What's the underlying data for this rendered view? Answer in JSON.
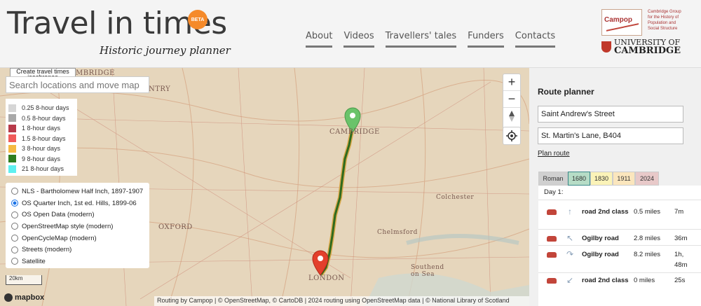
{
  "header": {
    "title": "Travel in times",
    "beta": "BETA",
    "tagline": "Historic journey planner",
    "nav": [
      "About",
      "Videos",
      "Travellers' tales",
      "Funders",
      "Contacts"
    ],
    "campop_logo": "Campop",
    "campop_desc": "Cambridge Group for the History of Population and Social Structure",
    "university": [
      "UNIVERSITY OF",
      "CAMBRIDGE"
    ]
  },
  "map": {
    "iso_button": "Create travel times isochrones",
    "search_placeholder": "Search locations and move map",
    "legend": [
      {
        "label": "0.25 8-hour days",
        "color": "#d6d6d6"
      },
      {
        "label": "0.5 8-hour days",
        "color": "#a8a8a8"
      },
      {
        "label": "1 8-hour days",
        "color": "#b73a4a"
      },
      {
        "label": "1.5 8-hour days",
        "color": "#f05a5a"
      },
      {
        "label": "3 8-hour days",
        "color": "#f5b942"
      },
      {
        "label": "9 8-hour days",
        "color": "#2e7d1f"
      },
      {
        "label": "21 8-hour days",
        "color": "#5ef0f0"
      }
    ],
    "layers": [
      {
        "label": "NLS - Bartholomew Half Inch, 1897-1907",
        "selected": false
      },
      {
        "label": "OS Quarter Inch, 1st ed. Hills, 1899-06",
        "selected": true
      },
      {
        "label": "OS Open Data (modern)",
        "selected": false
      },
      {
        "label": "OpenStreetMap style (modern)",
        "selected": false
      },
      {
        "label": "OpenCycleMap (modern)",
        "selected": false
      },
      {
        "label": "Streets (modern)",
        "selected": false
      },
      {
        "label": "Satellite",
        "selected": false
      }
    ],
    "place_labels": [
      "CAMBRIDGE",
      "OXFORD",
      "LONDON",
      "Chelmsford",
      "Colchester",
      "Southend on Sea",
      "NTRY",
      "MBRIDGE"
    ],
    "scale": "20km",
    "mapbox": "mapbox",
    "attribution": "Routing by Campop | © OpenStreetMap, © CartoDB | 2024 routing using OpenStreetMap data | © National Library of Scotland",
    "zoom_in": "+",
    "zoom_out": "−"
  },
  "panel": {
    "title": "Route planner",
    "from": "Saint Andrew's Street",
    "to": "St. Martin's Lane, B404",
    "plan_link": "Plan route",
    "eras": [
      {
        "label": "Roman",
        "color": "#d0d0d0"
      },
      {
        "label": "1680",
        "color": "#b6dcc6"
      },
      {
        "label": "1830",
        "color": "#fbf3b8"
      },
      {
        "label": "1911",
        "color": "#fbe6bd"
      },
      {
        "label": "2024",
        "color": "#e8c9c9"
      }
    ],
    "day_label": "Day 1:",
    "steps": [
      {
        "road": "road 2nd class",
        "distance": "0.5 miles",
        "time": "7m",
        "arrow": "↑"
      },
      {
        "road": "Ogilby road",
        "distance": "2.8 miles",
        "time": "36m",
        "arrow": "↖"
      },
      {
        "road": "Ogilby road",
        "distance": "8.2 miles",
        "time": "1h, 48m",
        "arrow": "↷"
      },
      {
        "road": "road 2nd class",
        "distance": "0 miles",
        "time": "25s",
        "arrow": "↙"
      }
    ]
  }
}
